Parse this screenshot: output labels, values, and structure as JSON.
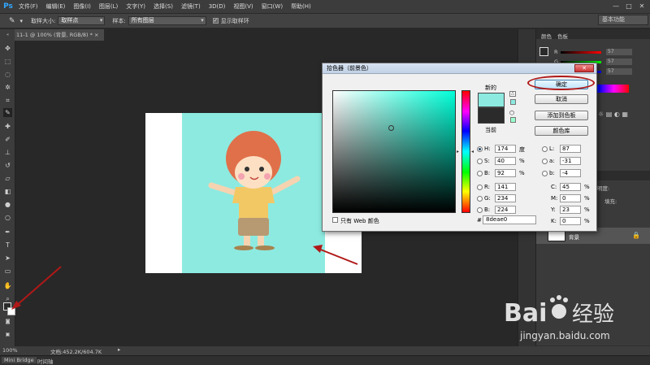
{
  "app": {
    "logo": "Ps"
  },
  "menu": [
    "文件(F)",
    "编辑(E)",
    "图像(I)",
    "图层(L)",
    "文字(Y)",
    "选择(S)",
    "滤镜(T)",
    "3D(D)",
    "视图(V)",
    "窗口(W)",
    "帮助(H)"
  ],
  "window_controls": [
    "—",
    "□",
    "✕"
  ],
  "options": {
    "tool_icon": "eyedropper-icon",
    "sample_size_label": "取样大小:",
    "sample_size_value": "取样点",
    "sample_label": "样本:",
    "sample_value": "所有图层",
    "show_ring_label": "显示取样环",
    "show_ring_checked": true,
    "workspace": "基本功能"
  },
  "document_tab": "11-1 @ 100% (背景, RGB/8) * ×",
  "tools": [
    "move-tool",
    "marquee-tool",
    "lasso-tool",
    "quick-select-tool",
    "crop-tool",
    "eyedropper-tool",
    "heal-tool",
    "brush-tool",
    "stamp-tool",
    "history-brush-tool",
    "eraser-tool",
    "gradient-tool",
    "blur-tool",
    "dodge-tool",
    "pen-tool",
    "type-tool",
    "path-select-tool",
    "shape-tool",
    "hand-tool",
    "zoom-tool"
  ],
  "statusbar": {
    "zoom": "100%",
    "doc_info": "文档:452.2K/604.7K"
  },
  "bottom_tabs": [
    "Mini Bridge",
    "时间轴"
  ],
  "color_panel": {
    "tabs": [
      "颜色",
      "色板"
    ],
    "r_label": "R",
    "g_label": "G",
    "b_label": "B",
    "r_value": "57",
    "g_value": "57",
    "b_value": "57"
  },
  "layers_panel": {
    "opacity_label": "不透明度:",
    "fill_label": "填充:",
    "layer_name": "背景",
    "lock_icon": "lock-icon"
  },
  "dialog": {
    "title": "拾色器（前景色）",
    "new_label": "新的",
    "current_label": "当前",
    "ok": "确定",
    "cancel": "取消",
    "add_to_swatches": "添加到色板",
    "color_libraries": "颜色库",
    "web_only": "只有 Web 颜色",
    "hex_prefix": "#",
    "hex": "8deae0",
    "new_color": "#8deae0",
    "current_color": "#2b2b2b",
    "fields": {
      "H": {
        "value": "174",
        "unit": "度"
      },
      "S": {
        "value": "40",
        "unit": "%"
      },
      "B": {
        "value": "92",
        "unit": "%"
      },
      "R": {
        "value": "141",
        "unit": ""
      },
      "G": {
        "value": "234",
        "unit": ""
      },
      "B2": {
        "value": "224",
        "unit": ""
      },
      "L": {
        "value": "87",
        "unit": ""
      },
      "a": {
        "value": "-31",
        "unit": ""
      },
      "b": {
        "value": "-4",
        "unit": ""
      },
      "C": {
        "value": "45",
        "unit": "%"
      },
      "M": {
        "value": "0",
        "unit": "%"
      },
      "Y": {
        "value": "23",
        "unit": "%"
      },
      "K": {
        "value": "0",
        "unit": "%"
      }
    }
  },
  "canvas": {
    "background": "#8deae0"
  },
  "watermark": {
    "brand": "Bai",
    "brand2": "经验",
    "url": "jingyan.baidu.com"
  },
  "annotation_color": "#b01818"
}
